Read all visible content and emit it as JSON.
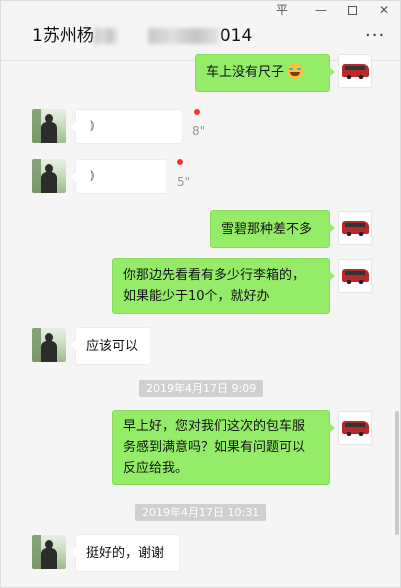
{
  "window_controls": {
    "pin": "平",
    "minimize": "—",
    "close": "✕"
  },
  "chat": {
    "title_prefix": "1苏州杨",
    "title_suffix": "014",
    "more": "···"
  },
  "messages": [
    {
      "side": "me",
      "type": "text",
      "text": "车上没有尺子",
      "emoji": "face-with-tears-of-joy"
    },
    {
      "side": "other",
      "type": "voice",
      "duration": "8\""
    },
    {
      "side": "other",
      "type": "voice",
      "duration": "5\""
    },
    {
      "side": "me",
      "type": "text",
      "text": "雪碧那种差不多"
    },
    {
      "side": "me",
      "type": "text",
      "lines": [
        "你那边先看看有多少行李箱的，",
        "如果能少于10个，就好办"
      ]
    },
    {
      "side": "other",
      "type": "text",
      "text": "应该可以"
    },
    {
      "type": "timestamp",
      "text": "2019年4月17日  9:09"
    },
    {
      "side": "me",
      "type": "text",
      "lines": [
        "早上好，您对我们这次的包车服",
        "务感到满意吗？如果有问题可以",
        "反应给我。"
      ]
    },
    {
      "type": "timestamp",
      "text": "2019年4月17日  10:31"
    },
    {
      "side": "other",
      "type": "text",
      "text": "挺好的，谢谢"
    }
  ],
  "colors": {
    "bubble_me": "#95ec69",
    "bubble_other": "#ffffff",
    "unread_dot": "#f43530",
    "background": "#f5f5f5"
  },
  "icons": {
    "voice": "voice-wave-icon",
    "my_avatar": "bus-avatar",
    "contact_avatar": "person-avatar"
  }
}
